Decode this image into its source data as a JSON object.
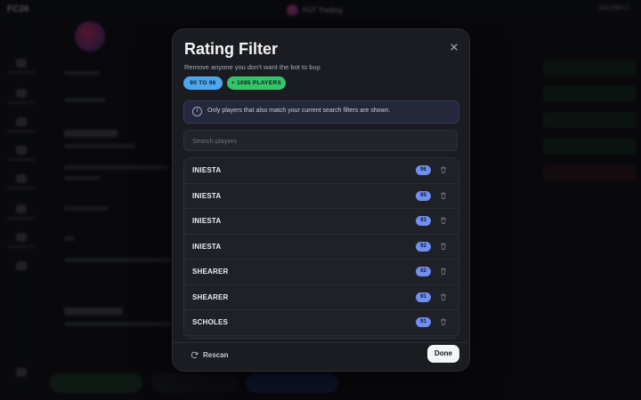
{
  "background": {
    "brand": "FC26",
    "center_title": "FUT Trading",
    "top_right": "JACOBFC1"
  },
  "modal": {
    "title": "Rating Filter",
    "subtitle": "Remove anyone you don't want the bot to buy.",
    "chips": {
      "range": "90 TO 96",
      "players": "+ 1085 PLAYERS"
    },
    "info_text": "Only players that also match your current search filters are shown.",
    "search_placeholder": "Search players",
    "players": [
      {
        "name": "INIESTA",
        "rating": "96"
      },
      {
        "name": "INIESTA",
        "rating": "95"
      },
      {
        "name": "INIESTA",
        "rating": "93"
      },
      {
        "name": "INIESTA",
        "rating": "92"
      },
      {
        "name": "SHEARER",
        "rating": "92"
      },
      {
        "name": "SHEARER",
        "rating": "91"
      },
      {
        "name": "SCHOLES",
        "rating": "91"
      }
    ],
    "rescan_label": "Rescan",
    "done_label": "Done"
  },
  "colors": {
    "range_chip": "#4da7ef",
    "players_chip": "#35c46c",
    "rating_badge": "#6f8ff2"
  }
}
